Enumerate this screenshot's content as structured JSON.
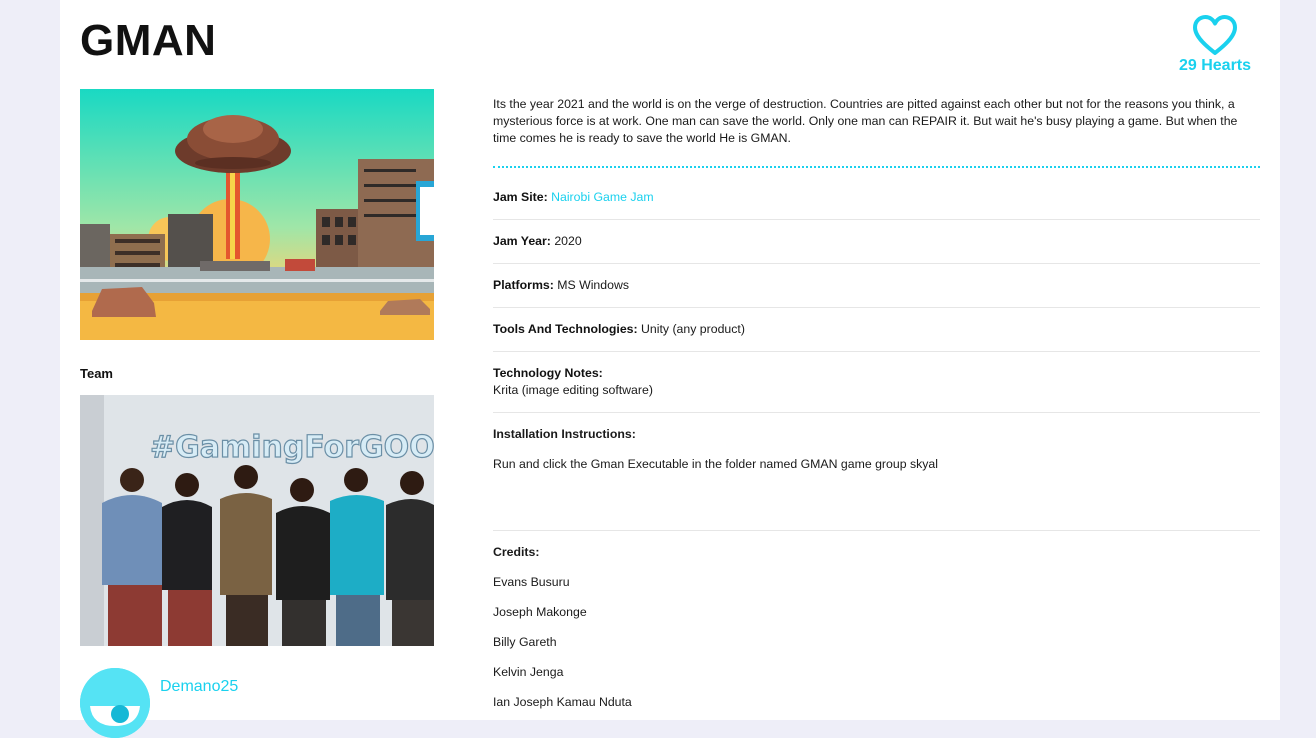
{
  "game": {
    "title": "GMAN",
    "hearts_label": "29 Hearts",
    "description": "Its the year 2021 and the world is on the verge of destruction. Countries are pitted against each other but not for the reasons you think, a mysterious force is at work. One man can save the world. Only one man can REPAIR it. But wait he's busy playing a game. But when the time comes he is ready to save the world He is GMAN."
  },
  "team": {
    "heading": "Team",
    "photo_banner_text": "#GamingForGOOD",
    "member_name": "Demano25"
  },
  "details": {
    "jam_site_label": "Jam Site:",
    "jam_site_value": "Nairobi Game Jam",
    "jam_year_label": "Jam Year:",
    "jam_year_value": "2020",
    "platforms_label": "Platforms:",
    "platforms_value": "MS Windows",
    "tools_label": "Tools And Technologies:",
    "tools_value": "Unity (any product)",
    "notes_label": "Technology Notes:",
    "notes_value": "Krita (image editing software)",
    "install_label": "Installation Instructions:",
    "install_value": "Run and click the Gman Executable in the folder named GMAN game group skyal",
    "credits_label": "Credits:",
    "credits": [
      "Evans Busuru",
      "Joseph Makonge",
      "Billy Gareth",
      "Kelvin Jenga",
      "Ian Joseph Kamau Nduta"
    ]
  },
  "colors": {
    "accent": "#1ad1ee",
    "page_background": "#eeeef8"
  },
  "icons": {
    "hearts": "heart-outline-icon"
  }
}
